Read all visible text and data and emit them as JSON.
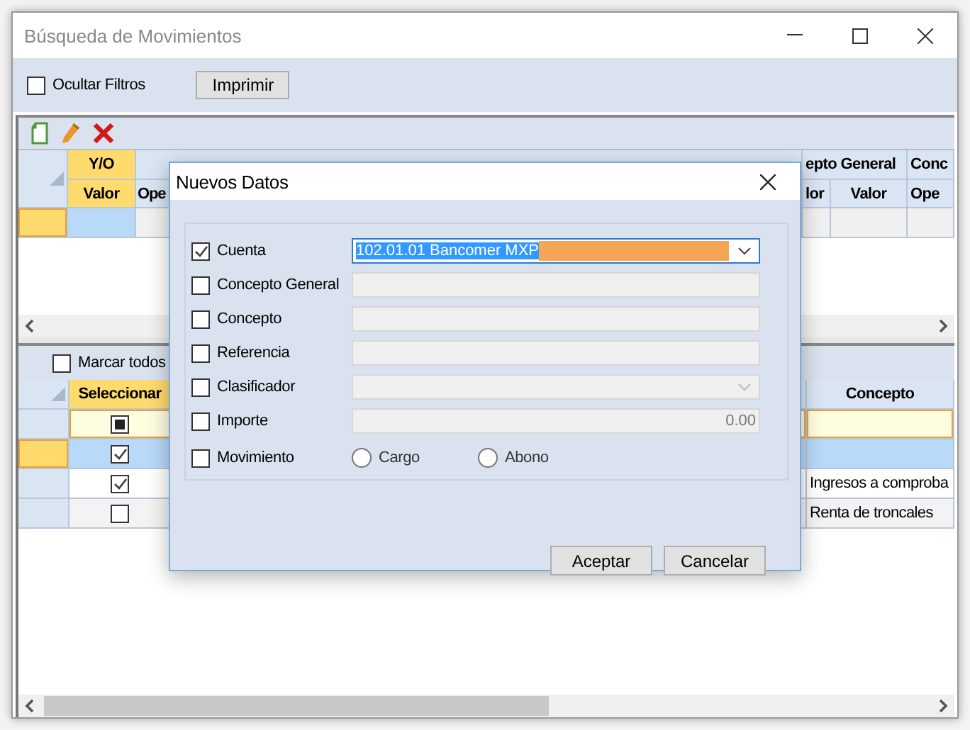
{
  "window": {
    "title": "Búsqueda de Movimientos"
  },
  "filters": {
    "hide_filters": {
      "label": "Ocultar Filtros",
      "checked": false
    },
    "print_button": "Imprimir"
  },
  "toolbar": [
    {
      "kind": "new"
    },
    {
      "kind": "edit"
    },
    {
      "kind": "delete"
    }
  ],
  "upper_grid": {
    "header_top": [
      "Y/O",
      "epto General",
      "Conc"
    ],
    "header_sub": [
      "Valor",
      "Ope",
      "lor",
      "Valor",
      "Ope"
    ]
  },
  "lower_panel": {
    "mark_all": {
      "label": "Marcar todos",
      "checked": false
    },
    "columns": [
      "Seleccionar",
      "Concepto"
    ],
    "rows": [
      {
        "checked": false,
        "indeterminate": true,
        "selected": false,
        "editing": true
      },
      {
        "checked": true,
        "indeterminate": false,
        "selected": true,
        "editing": false
      },
      {
        "checked": true,
        "indeterminate": false,
        "selected": false,
        "editing": false,
        "concepto": "Ingresos a comproba"
      },
      {
        "checked": false,
        "indeterminate": false,
        "selected": false,
        "editing": false,
        "concepto": "Renta de troncales"
      }
    ]
  },
  "dialog": {
    "title": "Nuevos Datos",
    "fields": [
      {
        "label": "Cuenta",
        "checked": true,
        "kind": "combo",
        "value": "102.01.01 Bancomer MXP",
        "disabled": false
      },
      {
        "label": "Concepto General",
        "checked": false,
        "kind": "text",
        "disabled": true
      },
      {
        "label": "Concepto",
        "checked": false,
        "kind": "text",
        "disabled": true
      },
      {
        "label": "Referencia",
        "checked": false,
        "kind": "text",
        "disabled": true
      },
      {
        "label": "Clasificador",
        "checked": false,
        "kind": "combo",
        "disabled": true
      },
      {
        "label": "Importe",
        "checked": false,
        "kind": "number",
        "value": "0.00",
        "disabled": true
      },
      {
        "label": "Movimiento",
        "checked": false,
        "kind": "radio",
        "options": [
          {
            "label": "Cargo",
            "selected": false
          },
          {
            "label": "Abono",
            "selected": false
          }
        ]
      }
    ],
    "buttons": [
      "Aceptar",
      "Cancelar"
    ]
  }
}
